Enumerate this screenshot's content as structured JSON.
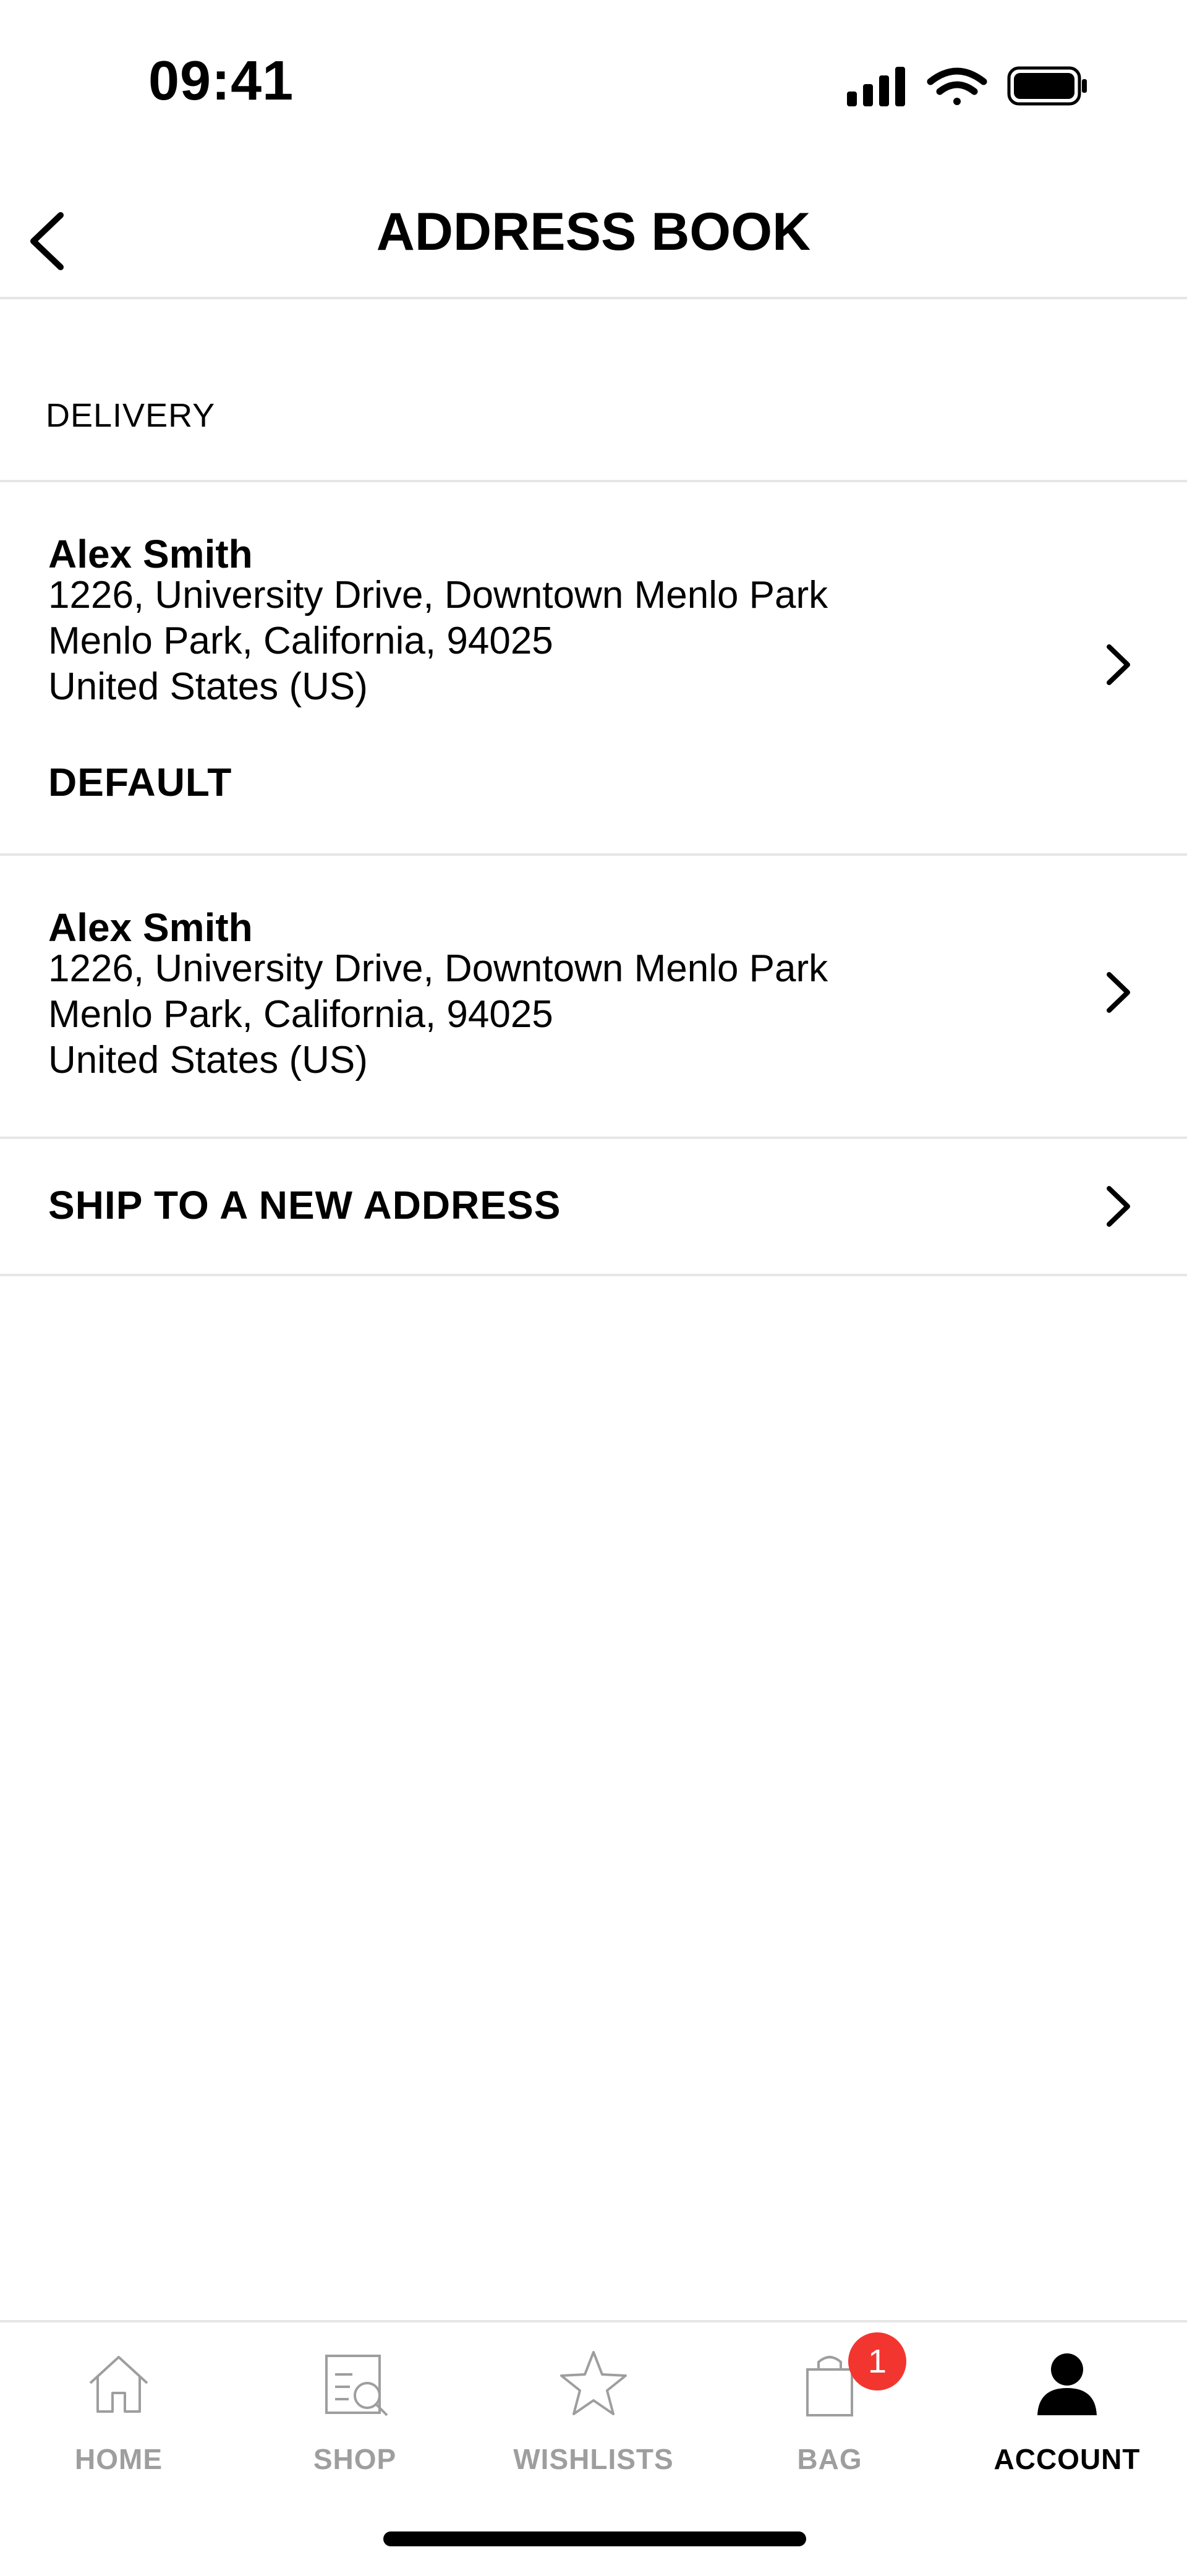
{
  "status_bar": {
    "time": "09:41"
  },
  "header": {
    "title": "ADDRESS BOOK"
  },
  "section": {
    "label": "DELIVERY"
  },
  "addresses": [
    {
      "name": "Alex Smith",
      "line1": "1226, University Drive, Downtown Menlo Park",
      "line2": "Menlo Park, California, 94025",
      "line3": "United States (US)",
      "badge": "DEFAULT"
    },
    {
      "name": "Alex Smith",
      "line1": "1226, University Drive, Downtown Menlo Park",
      "line2": "Menlo Park, California, 94025",
      "line3": "United States (US)"
    }
  ],
  "new_address": {
    "label": "SHIP TO A NEW ADDRESS"
  },
  "tabbar": {
    "tabs": [
      {
        "label": "HOME",
        "icon": "home-icon"
      },
      {
        "label": "SHOP",
        "icon": "shop-search-icon"
      },
      {
        "label": "WISHLISTS",
        "icon": "star-icon"
      },
      {
        "label": "BAG",
        "icon": "bag-icon"
      },
      {
        "label": "ACCOUNT",
        "icon": "account-icon"
      }
    ],
    "active": "ACCOUNT",
    "bag_count": "1"
  },
  "colors": {
    "badge": "#f2362f",
    "inactive_tab": "#9e9e9e",
    "divider": "#e6e6e6"
  }
}
